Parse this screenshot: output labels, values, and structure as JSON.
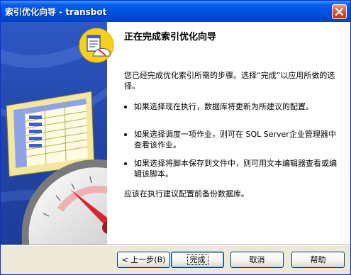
{
  "window": {
    "title": "索引优化向导 - transbot"
  },
  "header": {
    "title": "正在完成索引优化向导"
  },
  "body": {
    "intro": "您已经完成优化索引所需的步骤。选择“完成”以应用所做的选择。",
    "bullets": [
      "如果选择现在执行，数据库将更新为所建议的配置。",
      "如果选择调度一项作业，则可在 SQL Server企业管理器中查看该作业。",
      "如果选择将脚本保存到文件中，则可用文本编辑器查看或编辑该脚本。"
    ],
    "note": "应该在执行建议配置前备份数据库。"
  },
  "buttons": {
    "back": "< 上一步(B)",
    "finish": "完成",
    "cancel": "取消",
    "help": "帮助"
  },
  "colors": {
    "titlebar": "#0054e3",
    "sidebar": "#2a4fb4",
    "gauge_needle": "#d8262b"
  },
  "icons": {
    "header": "wizard-report-gauge-icon",
    "sidebar": "spreadsheet-gauge-illustration",
    "close": "close-icon"
  }
}
